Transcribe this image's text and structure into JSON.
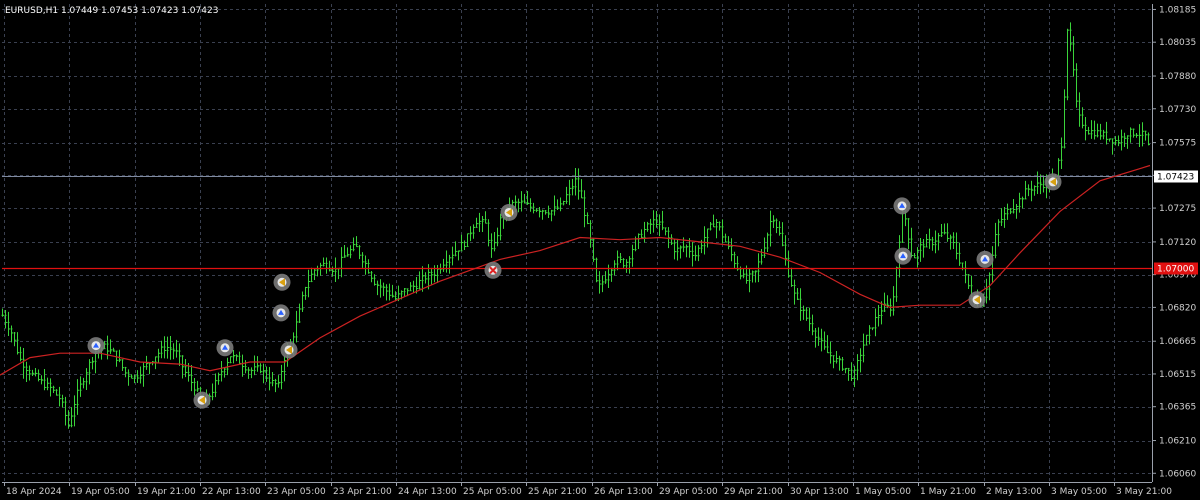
{
  "header": {
    "text": "EURUSD,H1  1.07449 1.07453 1.07423 1.07423"
  },
  "chart_data": {
    "type": "candlestick",
    "symbol": "EURUSD",
    "timeframe": "H1",
    "ylim": [
      1.0602,
      1.0821
    ],
    "y_ticks": [
      "1.08185",
      "1.08035",
      "1.07880",
      "1.07730",
      "1.07575",
      "1.07425",
      "1.07275",
      "1.07120",
      "1.06970",
      "1.06820",
      "1.06665",
      "1.06515",
      "1.06365",
      "1.06210",
      "1.06060"
    ],
    "x_ticks": [
      "18 Apr 2024",
      "19 Apr 05:00",
      "19 Apr 21:00",
      "22 Apr 13:00",
      "23 Apr 05:00",
      "23 Apr 21:00",
      "24 Apr 13:00",
      "25 Apr 05:00",
      "25 Apr 21:00",
      "26 Apr 13:00",
      "29 Apr 05:00",
      "29 Apr 21:00",
      "30 Apr 13:00",
      "1 May 05:00",
      "1 May 21:00",
      "2 May 13:00",
      "3 May 05:00",
      "3 May 21:00"
    ],
    "current_price": "1.07423",
    "level_line": "1.07000",
    "close_path": [
      [
        0,
        1.068
      ],
      [
        10,
        1.0672
      ],
      [
        20,
        1.0658
      ],
      [
        30,
        1.0652
      ],
      [
        40,
        1.0648
      ],
      [
        50,
        1.0645
      ],
      [
        60,
        1.064
      ],
      [
        68,
        1.0628
      ],
      [
        75,
        1.064
      ],
      [
        85,
        1.0652
      ],
      [
        95,
        1.0662
      ],
      [
        105,
        1.0664
      ],
      [
        115,
        1.066
      ],
      [
        125,
        1.0652
      ],
      [
        135,
        1.065
      ],
      [
        145,
        1.0655
      ],
      [
        155,
        1.066
      ],
      [
        165,
        1.0664
      ],
      [
        175,
        1.0662
      ],
      [
        185,
        1.0652
      ],
      [
        195,
        1.0645
      ],
      [
        202,
        1.0638
      ],
      [
        210,
        1.0642
      ],
      [
        220,
        1.0652
      ],
      [
        230,
        1.066
      ],
      [
        240,
        1.0657
      ],
      [
        250,
        1.0653
      ],
      [
        260,
        1.0654
      ],
      [
        270,
        1.0648
      ],
      [
        278,
        1.0646
      ],
      [
        283,
        1.0658
      ],
      [
        290,
        1.0665
      ],
      [
        297,
        1.0676
      ],
      [
        305,
        1.0692
      ],
      [
        315,
        1.07
      ],
      [
        325,
        1.0702
      ],
      [
        335,
        1.0699
      ],
      [
        345,
        1.0706
      ],
      [
        355,
        1.071
      ],
      [
        365,
        1.0702
      ],
      [
        375,
        1.0693
      ],
      [
        385,
        1.069
      ],
      [
        395,
        1.0686
      ],
      [
        405,
        1.069
      ],
      [
        415,
        1.0692
      ],
      [
        425,
        1.0696
      ],
      [
        435,
        1.0698
      ],
      [
        445,
        1.0704
      ],
      [
        455,
        1.0708
      ],
      [
        465,
        1.0712
      ],
      [
        475,
        1.0722
      ],
      [
        485,
        1.072
      ],
      [
        492,
        1.0706
      ],
      [
        500,
        1.0722
      ],
      [
        510,
        1.0729
      ],
      [
        520,
        1.073
      ],
      [
        530,
        1.0728
      ],
      [
        540,
        1.0727
      ],
      [
        550,
        1.0726
      ],
      [
        560,
        1.0728
      ],
      [
        567,
        1.0734
      ],
      [
        575,
        1.074
      ],
      [
        582,
        1.073
      ],
      [
        590,
        1.0712
      ],
      [
        597,
        1.069
      ],
      [
        605,
        1.0696
      ],
      [
        615,
        1.0704
      ],
      [
        625,
        1.0702
      ],
      [
        635,
        1.0712
      ],
      [
        645,
        1.0718
      ],
      [
        655,
        1.0722
      ],
      [
        665,
        1.0716
      ],
      [
        675,
        1.0708
      ],
      [
        685,
        1.071
      ],
      [
        695,
        1.0706
      ],
      [
        705,
        1.0715
      ],
      [
        715,
        1.0722
      ],
      [
        725,
        1.0712
      ],
      [
        735,
        1.0702
      ],
      [
        745,
        1.0694
      ],
      [
        755,
        1.0698
      ],
      [
        765,
        1.0712
      ],
      [
        772,
        1.0725
      ],
      [
        780,
        1.0714
      ],
      [
        788,
        1.0698
      ],
      [
        795,
        1.0686
      ],
      [
        805,
        1.0678
      ],
      [
        815,
        1.067
      ],
      [
        825,
        1.0662
      ],
      [
        835,
        1.0658
      ],
      [
        845,
        1.0654
      ],
      [
        853,
        1.065
      ],
      [
        862,
        1.0664
      ],
      [
        872,
        1.0674
      ],
      [
        882,
        1.0682
      ],
      [
        892,
        1.0682
      ],
      [
        898,
        1.071
      ],
      [
        903,
        1.0728
      ],
      [
        912,
        1.0704
      ],
      [
        922,
        1.0711
      ],
      [
        932,
        1.0712
      ],
      [
        942,
        1.0716
      ],
      [
        952,
        1.0712
      ],
      [
        962,
        1.07
      ],
      [
        972,
        1.0686
      ],
      [
        980,
        1.0684
      ],
      [
        988,
        1.0694
      ],
      [
        997,
        1.072
      ],
      [
        1007,
        1.0726
      ],
      [
        1017,
        1.073
      ],
      [
        1027,
        1.0736
      ],
      [
        1037,
        1.0738
      ],
      [
        1047,
        1.0739
      ],
      [
        1055,
        1.074
      ],
      [
        1062,
        1.076
      ],
      [
        1067,
        1.081
      ],
      [
        1072,
        1.0795
      ],
      [
        1077,
        1.077
      ],
      [
        1087,
        1.0763
      ],
      [
        1097,
        1.0762
      ],
      [
        1107,
        1.076
      ],
      [
        1117,
        1.0758
      ],
      [
        1127,
        1.0762
      ],
      [
        1137,
        1.0762
      ],
      [
        1147,
        1.076
      ],
      [
        1151,
        1.0742
      ]
    ],
    "moving_average": [
      [
        0,
        1.0651
      ],
      [
        30,
        1.0659
      ],
      [
        60,
        1.0661
      ],
      [
        100,
        1.0661
      ],
      [
        140,
        1.0657
      ],
      [
        180,
        1.0656
      ],
      [
        210,
        1.0653
      ],
      [
        250,
        1.0657
      ],
      [
        285,
        1.0657
      ],
      [
        320,
        1.0668
      ],
      [
        360,
        1.0678
      ],
      [
        400,
        1.0686
      ],
      [
        440,
        1.0694
      ],
      [
        470,
        1.0699
      ],
      [
        500,
        1.0704
      ],
      [
        540,
        1.0708
      ],
      [
        580,
        1.0714
      ],
      [
        620,
        1.0713
      ],
      [
        660,
        1.0714
      ],
      [
        700,
        1.0712
      ],
      [
        740,
        1.071
      ],
      [
        780,
        1.0705
      ],
      [
        820,
        1.0698
      ],
      [
        860,
        1.0688
      ],
      [
        890,
        1.0682
      ],
      [
        920,
        1.0683
      ],
      [
        960,
        1.0683
      ],
      [
        990,
        1.0692
      ],
      [
        1020,
        1.0707
      ],
      [
        1060,
        1.0726
      ],
      [
        1100,
        1.074
      ],
      [
        1150,
        1.0747
      ]
    ],
    "markers": [
      {
        "idx": 96,
        "price": 1.06645,
        "sym": "up"
      },
      {
        "idx": 202,
        "price": 1.06395,
        "sym": "left"
      },
      {
        "idx": 225,
        "price": 1.06635,
        "sym": "up"
      },
      {
        "idx": 282,
        "price": 1.06935,
        "sym": "left"
      },
      {
        "idx": 281,
        "price": 1.06795,
        "sym": "up"
      },
      {
        "idx": 289,
        "price": 1.06625,
        "sym": "left"
      },
      {
        "idx": 493,
        "price": 1.0699,
        "sym": "x"
      },
      {
        "idx": 509,
        "price": 1.07255,
        "sym": "left"
      },
      {
        "idx": 902,
        "price": 1.07285,
        "sym": "up"
      },
      {
        "idx": 903,
        "price": 1.07055,
        "sym": "up"
      },
      {
        "idx": 977,
        "price": 1.06855,
        "sym": "left"
      },
      {
        "idx": 985,
        "price": 1.0704,
        "sym": "up"
      },
      {
        "idx": 1053,
        "price": 1.07395,
        "sym": "left"
      }
    ],
    "colors": {
      "background": "#000000",
      "grid": "#3a4050",
      "candle": "#3ad43a",
      "moving_average": "#cc2222",
      "level_line": "#e01010",
      "current_price_line": "#7f8aa0",
      "current_price_tag": "#ffffff",
      "level_tag": "#e01010",
      "marker_ring": "#7a7a7a",
      "marker_up": "#2a60ff",
      "marker_left": "#d8a010",
      "marker_x": "#e02020",
      "marker_inner": "#e8e8e8"
    }
  }
}
